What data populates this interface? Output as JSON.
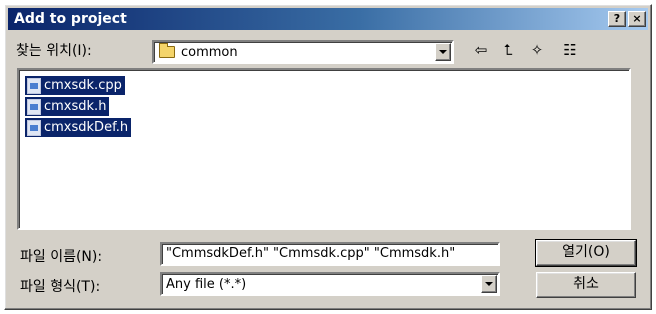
{
  "window": {
    "title": "Add to project",
    "help_label": "?",
    "close_label": "×"
  },
  "lookin": {
    "label": "찾는 위치(I):",
    "value": "common"
  },
  "toolbar": {
    "back_icon": "⇦",
    "up_icon": "⮤",
    "newfolder_icon": "✧",
    "view_icon": "☷"
  },
  "files": [
    {
      "name": "cmxsdk.cpp",
      "icon": "cpp-file-icon"
    },
    {
      "name": "cmxsdk.h",
      "icon": "header-file-icon"
    },
    {
      "name": "cmxsdkDef.h",
      "icon": "header-file-icon"
    }
  ],
  "filename": {
    "label": "파일 이름(N):",
    "value": "\"CmmsdkDef.h\" \"Cmmsdk.cpp\" \"Cmmsdk.h\""
  },
  "filetype": {
    "label": "파일 형식(T):",
    "value": "Any file (*.*)"
  },
  "buttons": {
    "open": "열기(O)",
    "cancel": "취소"
  }
}
